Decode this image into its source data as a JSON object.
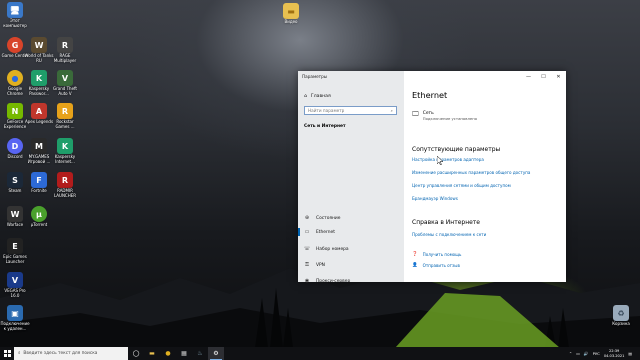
{
  "desktop_icons": [
    {
      "label": "Этот компьютер",
      "glyph": "🖥",
      "color": "#3a78c8"
    },
    {
      "label": "Game Center",
      "glyph": "G",
      "color": "#d8442a"
    },
    {
      "label": "World of Tanks RU",
      "glyph": "W",
      "color": "#5a4a30"
    },
    {
      "label": "RAGE Multiplayer",
      "glyph": "R",
      "color": "#444"
    },
    {
      "label": "Google Chrome",
      "glyph": "●",
      "color": "#e0b020"
    },
    {
      "label": "Kaspersky Passwor...",
      "glyph": "K",
      "color": "#1f9e6a"
    },
    {
      "label": "Grand Theft Auto V",
      "glyph": "V",
      "color": "#3a6a3a"
    },
    {
      "label": "GeForce Experience",
      "glyph": "N",
      "color": "#76b900"
    },
    {
      "label": "Apex Legends",
      "glyph": "A",
      "color": "#c0362c"
    },
    {
      "label": "Rockstar Games ...",
      "glyph": "R",
      "color": "#e7a21a"
    },
    {
      "label": "Discord",
      "glyph": "D",
      "color": "#5865f2"
    },
    {
      "label": "MY.GAMES Игровой ...",
      "glyph": "M",
      "color": "#2a2a2a"
    },
    {
      "label": "Kaspersky Internet...",
      "glyph": "K",
      "color": "#1f9e6a"
    },
    {
      "label": "Steam",
      "glyph": "S",
      "color": "#1b2838"
    },
    {
      "label": "Fortnite",
      "glyph": "F",
      "color": "#2d6ad6"
    },
    {
      "label": "RADMIR LAUNCHER",
      "glyph": "R",
      "color": "#b21c1c"
    },
    {
      "label": "Warface",
      "glyph": "W",
      "color": "#333"
    },
    {
      "label": "μTorrent",
      "glyph": "μ",
      "color": "#4aa02c"
    },
    {
      "label": "Epic Games Launcher",
      "glyph": "E",
      "color": "#222"
    },
    {
      "label": "VEGAS Pro 16.0",
      "glyph": "V",
      "color": "#1a3a8a"
    },
    {
      "label": "Подключение к удален...",
      "glyph": "▣",
      "color": "#2a6ab0"
    },
    {
      "label": "Видео",
      "glyph": "📁",
      "color": "#e8c050"
    },
    {
      "label": "Корзина",
      "glyph": "🗑",
      "color": "#9ab"
    }
  ],
  "window": {
    "app_title": "Параметры",
    "controls": {
      "minimize": "—",
      "maximize": "☐",
      "close": "✕"
    },
    "home_label": "Главная",
    "search_placeholder": "Найти параметр",
    "section_label": "Сеть и Интернет",
    "nav": [
      {
        "icon": "globe-icon",
        "glyph": "⊕",
        "label": "Состояние"
      },
      {
        "icon": "ethernet-icon",
        "glyph": "▭",
        "label": "Ethernet"
      },
      {
        "icon": "dialup-icon",
        "glyph": "☏",
        "label": "Набор номера"
      },
      {
        "icon": "vpn-icon",
        "glyph": "⚿",
        "label": "VPN"
      },
      {
        "icon": "proxy-icon",
        "glyph": "◉",
        "label": "Прокси-сервер"
      }
    ],
    "page_title": "Ethernet",
    "network": {
      "name": "Сеть",
      "status": "Подключение установлено"
    },
    "related_title": "Сопутствующие параметры",
    "related_links": [
      "Настройка параметров адаптера",
      "Изменение расширенных параметров общего доступа",
      "Центр управления сетями и общим доступом",
      "Брандмауэр Windows"
    ],
    "web_help_title": "Справка в Интернете",
    "web_help_link": "Проблемы с подключением к сети",
    "help": [
      {
        "icon": "help-icon",
        "glyph": "❓",
        "label": "Получить помощь"
      },
      {
        "icon": "feedback-icon",
        "glyph": "👤",
        "label": "Отправить отзыв"
      }
    ]
  },
  "taskbar": {
    "search_placeholder": "Введите здесь текст для поиска",
    "language": "РУС",
    "time": "22:39",
    "date": "04.03.2021"
  },
  "colors": {
    "accent": "#0063b1",
    "link": "#0063b1"
  }
}
